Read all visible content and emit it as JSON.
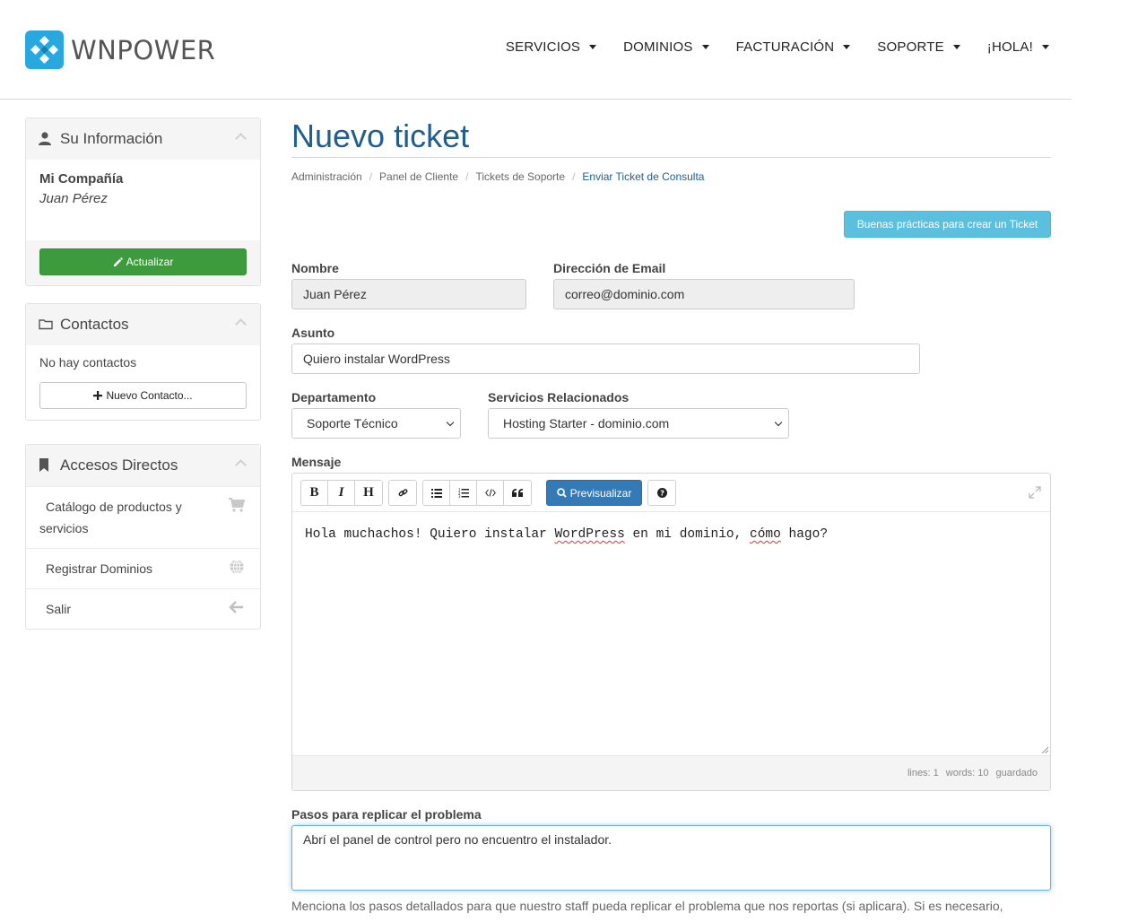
{
  "brand": {
    "name": "WNPOWER",
    "colors": {
      "primary": "#1f5e8e",
      "logo": "#29a8e0",
      "success": "#3d9b3d",
      "info": "#5bc0de",
      "button_primary": "#337ab7"
    }
  },
  "nav": {
    "items": [
      {
        "label": "SERVICIOS"
      },
      {
        "label": "DOMINIOS"
      },
      {
        "label": "FACTURACIÓN"
      },
      {
        "label": "SOPORTE"
      },
      {
        "label": "¡HOLA!"
      }
    ]
  },
  "sidebar": {
    "info": {
      "title": "Su Información",
      "icon": "user-icon",
      "company": "Mi Compañía",
      "person": "Juan Pérez",
      "update_label": "Actualizar"
    },
    "contacts": {
      "title": "Contactos",
      "icon": "folder-icon",
      "empty_text": "No hay contactos",
      "new_label": "Nuevo Contacto..."
    },
    "shortcuts": {
      "title": "Accesos Directos",
      "icon": "bookmark-icon",
      "items": [
        {
          "label_line1": "Catálogo de productos y",
          "label_line2": "servicios",
          "icon": "cart-icon"
        },
        {
          "label": "Registrar Dominios",
          "icon": "globe-icon"
        },
        {
          "label": "Salir",
          "icon": "arrow-left-icon"
        }
      ]
    }
  },
  "main": {
    "title": "Nuevo ticket",
    "breadcrumb": [
      "Administración",
      "Panel de Cliente",
      "Tickets de Soporte",
      "Enviar Ticket de Consulta"
    ],
    "tip_button": "Buenas prácticas para crear un Ticket",
    "form": {
      "name_label": "Nombre",
      "name_value": "Juan Pérez",
      "email_label": "Dirección de Email",
      "email_value": "correo@dominio.com",
      "subject_label": "Asunto",
      "subject_value": "Quiero instalar WordPress",
      "department_label": "Departamento",
      "department_value": "Soporte Técnico",
      "services_label": "Servicios Relacionados",
      "services_value": "Hosting Starter - dominio.com",
      "message_label": "Mensaje",
      "message": {
        "part1": "Hola muchachos! Quiero instalar ",
        "word1": "WordPress",
        "part2": " en mi dominio, ",
        "word2": "cómo",
        "part3": " hago?"
      },
      "preview_label": "Previsualizar",
      "status": {
        "lines": "lines: 1",
        "words": "words: 10",
        "saved": "guardado"
      },
      "steps_label": "Pasos para replicar el problema",
      "steps_value": "Abrí el panel de control pero no encuentro el instalador.",
      "steps_help": "Menciona los pasos detallados para que nuestro staff pueda replicar el problema que nos reportas (si aplicara). Si es necesario,"
    }
  }
}
